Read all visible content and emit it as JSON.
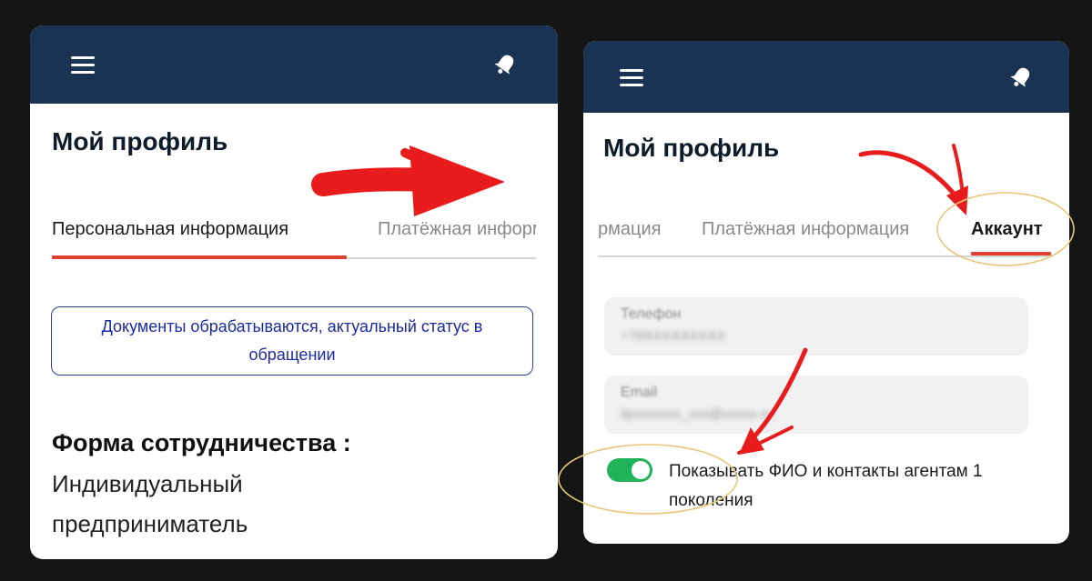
{
  "left_screen": {
    "title": "Мой профиль",
    "tabs": [
      {
        "label": "Персональная информация"
      },
      {
        "label": "Платёжная информация"
      }
    ],
    "notice": "Документы обрабатываются, актуальный статус в обращении",
    "cooperation_label": "Форма сотрудничества :",
    "cooperation_value": "Индивидуальный предприниматель"
  },
  "right_screen": {
    "title": "Мой профиль",
    "tabs": [
      {
        "label": "рмация"
      },
      {
        "label": "Платёжная информация"
      },
      {
        "label": "Аккаунт"
      }
    ],
    "phone": {
      "label": "Телефон",
      "value": "+79XXXXXXXXX"
    },
    "email": {
      "label": "Email",
      "value": "ilyxxxxxxx_xxx@xxxxx.ru"
    },
    "toggle": {
      "label": "Показывать ФИО и контакты агентам 1 поколения",
      "on": true
    }
  },
  "icons": {
    "menu": "hamburger-menu-icon",
    "notifications": "bell-icon"
  },
  "colors": {
    "header": "#1b3352",
    "accent_red": "#e0402f",
    "toggle_on": "#21b35a",
    "notice_text": "#1d2aa3",
    "annotation": "#e81c1c",
    "highlight_circle": "#e8c77a"
  }
}
